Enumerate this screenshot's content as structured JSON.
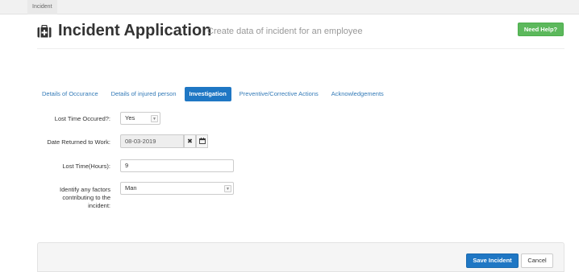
{
  "breadcrumb": {
    "item": "Incident"
  },
  "header": {
    "icon": "first-aid-kit-icon",
    "title": "Incident Application",
    "subtitle": "Create data of incident for an employee",
    "help_label": "Need Help?",
    "help_color": "#5cb85c"
  },
  "tabs": [
    {
      "label": "Details of Occurance",
      "active": false
    },
    {
      "label": "Details of injured person",
      "active": false
    },
    {
      "label": "Investigation",
      "active": true
    },
    {
      "label": "Preventive/Corrective Actions",
      "active": false
    },
    {
      "label": "Acknowledgements",
      "active": false
    }
  ],
  "form": {
    "lost_time_occured": {
      "label": "Lost Time Occured?:",
      "value": "Yes"
    },
    "date_returned": {
      "label": "Date Returned to Work:",
      "value": "08-03-2019",
      "clear_icon": "close-icon",
      "calendar_icon": "calendar-icon"
    },
    "lost_time_hours": {
      "label": "Lost Time(Hours):",
      "value": "9"
    },
    "factors": {
      "label_line1": "Identify any factors",
      "label_line2": "contributing to the",
      "label_line3": "incident:",
      "value": "Man"
    }
  },
  "footer": {
    "save_label": "Save Incident",
    "cancel_label": "Cancel"
  },
  "colors": {
    "primary": "#1f77c4",
    "success": "#5cb85c"
  }
}
